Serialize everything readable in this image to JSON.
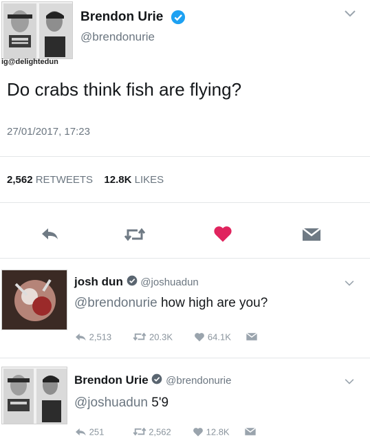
{
  "main_tweet": {
    "name": "Brendon Urie",
    "handle": "@brendonurie",
    "watermark": "ig@delightedun",
    "text": "Do crabs think fish are flying?",
    "timestamp": "27/01/2017, 17:23",
    "retweets_count": "2,562",
    "retweets_label": "RETWEETS",
    "likes_count": "12.8K",
    "likes_label": "LIKES"
  },
  "reply1": {
    "name": "josh dun",
    "handle": "@joshuadun",
    "mention": "@brendonurie",
    "text": " how high are you?",
    "reply_count": "2,513",
    "retweet_count": "20.3K",
    "like_count": "64.1K"
  },
  "reply2": {
    "name": "Brendon Urie",
    "handle": "@brendonurie",
    "mention": "@joshuadun",
    "text": " 5'9",
    "reply_count": "251",
    "retweet_count": "2,562",
    "like_count": "12.8K"
  },
  "icons": [
    "verified-badge-icon",
    "chevron-down-icon",
    "reply-icon",
    "retweet-icon",
    "heart-icon",
    "dm-icon"
  ],
  "colors": {
    "heart": "#e0245e",
    "verified": "#1da1f2",
    "handle": "#6b7680",
    "mention": "#1b95e0"
  }
}
